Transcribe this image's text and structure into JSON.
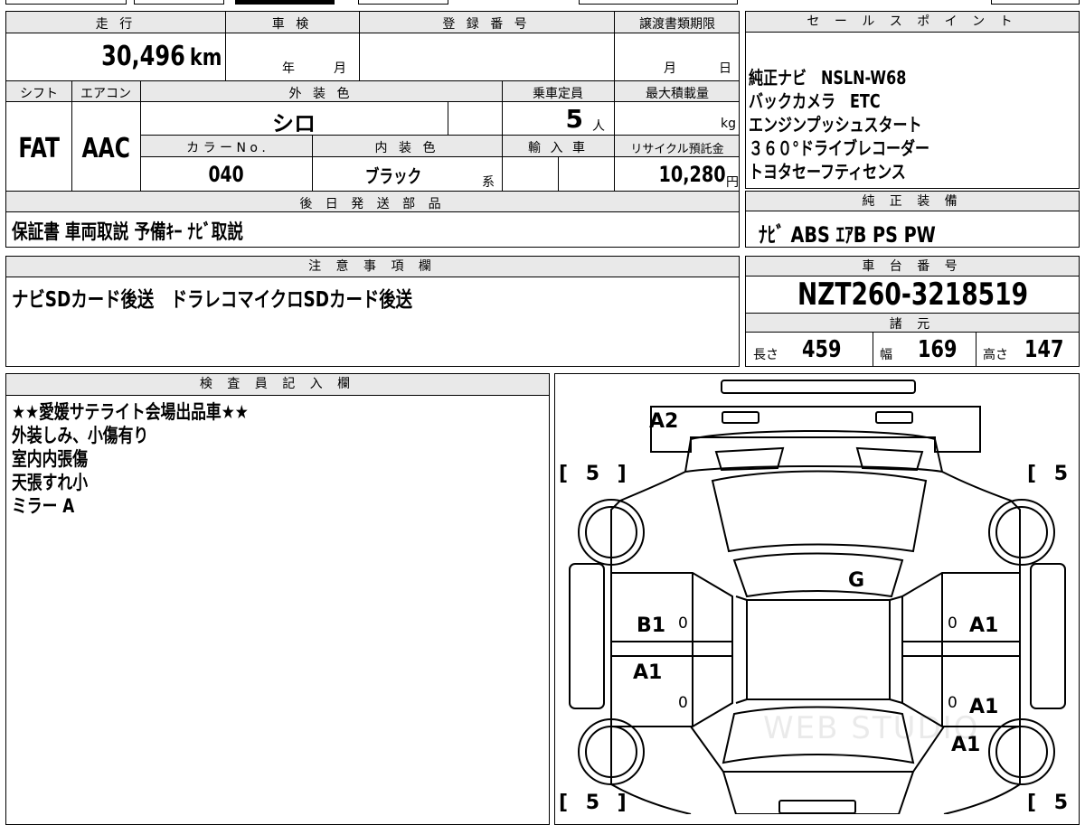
{
  "top": {
    "headers": {
      "mileage": "走 行",
      "inspection": "車 検",
      "registration": "登 録 番 号",
      "transfer": "譲渡書類期限",
      "shift": "シフト",
      "aircon": "エアコン",
      "ext_color": "外 装 色",
      "capacity": "乗車定員",
      "max_load": "最大積載量",
      "color_no": "カ ラ ー N o .",
      "int_color": "内 装 色",
      "import": "輸 入 車",
      "recycle": "リサイクル預託金"
    },
    "mileage_value": "30,496",
    "mileage_unit": "km",
    "inspection_year": "年",
    "inspection_month": "月",
    "transfer_month": "月",
    "transfer_day": "日",
    "shift_value": "FAT",
    "aircon_value": "AAC",
    "ext_color_value": "シロ",
    "capacity_value": "5",
    "capacity_unit": "人",
    "max_load_unit": "kg",
    "color_no_value": "040",
    "int_color_value": "ブラック",
    "int_color_suffix": "系",
    "recycle_value": "10,280",
    "recycle_unit": "円"
  },
  "sales_points": {
    "header": "セ ー ル ス ポ イ ン ト",
    "items": [
      "純正ナビ　NSLN-W68",
      "バックカメラ　ETC",
      "エンジンプッシュスタート",
      "３６０°ドライブレコーダー",
      "トヨタセーフティセンス"
    ]
  },
  "later_parts": {
    "header": "後 日 発 送 部 品",
    "value": "保証書 車両取説 予備ｷｰ ﾅﾋﾞ取説"
  },
  "genuine_equipment": {
    "header": "純 正 装 備",
    "value": "ﾅﾋﾞ ABS ｴｱB PS PW"
  },
  "notes": {
    "header": "注 意 事 項 欄",
    "value": "ナビSDカード後送　ドラレコマイクロSDカード後送"
  },
  "chassis": {
    "header": "車 台 番 号",
    "value": "NZT260-3218519"
  },
  "specs": {
    "header": "諸 元",
    "length_label": "長さ",
    "length_value": "459",
    "width_label": "幅",
    "width_value": "169",
    "height_label": "高さ",
    "height_value": "147"
  },
  "inspector": {
    "header": "検 査 員 記 入 欄",
    "lines": [
      "★★愛媛サテライト会場出品車★★",
      "外装しみ、小傷有り",
      "室内内張傷",
      "天張すれ小",
      "ミラー A"
    ]
  },
  "diagram": {
    "tire_tread": "[ 5 ]",
    "marks": {
      "rear": "A2",
      "roof": "G",
      "left_front_door": "B1",
      "left_rear_door": "A1",
      "right_front_door": "A1",
      "right_rear_door": "A1",
      "right_rear_quarter": "A1"
    },
    "zero": "0",
    "watermark": "WEB STUDIO"
  }
}
